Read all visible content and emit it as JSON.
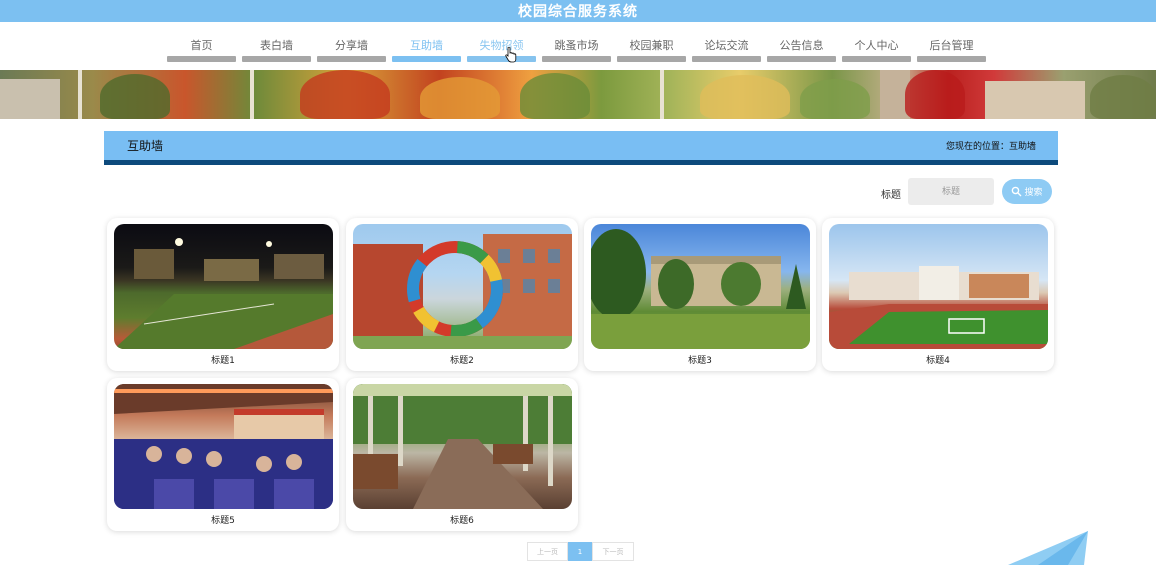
{
  "app": {
    "title": "校园综合服务系统"
  },
  "nav": {
    "items": [
      {
        "label": "首页"
      },
      {
        "label": "表白墙"
      },
      {
        "label": "分享墙"
      },
      {
        "label": "互助墙"
      },
      {
        "label": "失物招领"
      },
      {
        "label": "跳蚤市场"
      },
      {
        "label": "校园兼职"
      },
      {
        "label": "论坛交流"
      },
      {
        "label": "公告信息"
      },
      {
        "label": "个人中心"
      },
      {
        "label": "后台管理"
      }
    ],
    "active_index": 3,
    "hover_index": 4
  },
  "section": {
    "title": "互助墙",
    "breadcrumb": "您现在的位置：互助墙"
  },
  "search": {
    "label": "标题",
    "placeholder": "标题",
    "button_label": "搜索"
  },
  "cards": [
    {
      "title": "标题1"
    },
    {
      "title": "标题2"
    },
    {
      "title": "标题3"
    },
    {
      "title": "标题4"
    },
    {
      "title": "标题5"
    },
    {
      "title": "标题6"
    }
  ],
  "pagination": {
    "prev_label": "上一页",
    "current_page": "1",
    "next_label": "下一页"
  },
  "colors": {
    "accent": "#7cc0f1",
    "header_border": "#0d4a7c",
    "nav_bar": "#a7a7a7"
  }
}
